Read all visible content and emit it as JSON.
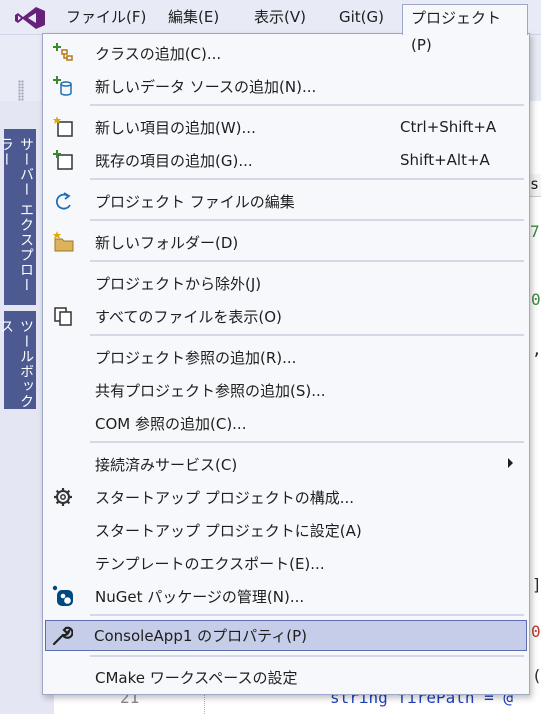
{
  "menubar": {
    "items": [
      {
        "label": "ファイル(F)"
      },
      {
        "label": "編集(E)"
      },
      {
        "label": "表示(V)"
      },
      {
        "label": "Git(G)"
      },
      {
        "label": "プロジェクト(P)"
      }
    ]
  },
  "side_tabs": {
    "solution_explorer": "サーバー エクスプローラー",
    "toolbox": "ツールボックス"
  },
  "editor": {
    "tab_fragment": "s.",
    "line_number": "21",
    "code_fragment": "string firePath = @",
    "peek_right": [
      "7",
      "0",
      ",",
      "]",
      "0",
      "("
    ]
  },
  "dropdown": {
    "items": [
      {
        "label": "クラスの追加(C)...",
        "shortcut": "",
        "icon": "add-class-icon"
      },
      {
        "label": "新しいデータ ソースの追加(N)...",
        "shortcut": "",
        "icon": "add-datasource-icon"
      },
      {
        "label": "新しい項目の追加(W)...",
        "shortcut": "Ctrl+Shift+A",
        "icon": "new-item-icon"
      },
      {
        "label": "既存の項目の追加(G)...",
        "shortcut": "Shift+Alt+A",
        "icon": "existing-item-icon"
      },
      {
        "label": "プロジェクト ファイルの編集",
        "shortcut": "",
        "icon": "edit-project-icon"
      },
      {
        "label": "新しいフォルダー(D)",
        "shortcut": "",
        "icon": "new-folder-icon"
      },
      {
        "label": "プロジェクトから除外(J)",
        "shortcut": "",
        "icon": ""
      },
      {
        "label": "すべてのファイルを表示(O)",
        "shortcut": "",
        "icon": "show-all-files-icon"
      },
      {
        "label": "プロジェクト参照の追加(R)...",
        "shortcut": "",
        "icon": ""
      },
      {
        "label": "共有プロジェクト参照の追加(S)...",
        "shortcut": "",
        "icon": ""
      },
      {
        "label": "COM 参照の追加(C)...",
        "shortcut": "",
        "icon": ""
      },
      {
        "label": "接続済みサービス(C)",
        "shortcut": "",
        "icon": ""
      },
      {
        "label": "スタートアップ プロジェクトの構成...",
        "shortcut": "",
        "icon": "gear-icon"
      },
      {
        "label": "スタートアップ プロジェクトに設定(A)",
        "shortcut": "",
        "icon": ""
      },
      {
        "label": "テンプレートのエクスポート(E)...",
        "shortcut": "",
        "icon": ""
      },
      {
        "label": "NuGet パッケージの管理(N)...",
        "shortcut": "",
        "icon": "nuget-icon"
      },
      {
        "label": "ConsoleApp1 のプロパティ(P)",
        "shortcut": "",
        "icon": "wrench-icon"
      },
      {
        "label": "CMake ワークスペースの設定",
        "shortcut": "",
        "icon": ""
      }
    ]
  },
  "colors": {
    "accent": "#68217a",
    "menu_bg": "#f7f8fc",
    "highlight_bg": "#c6cde9",
    "highlight_border": "#5d6db0",
    "side_tab_bg": "#4d5991"
  }
}
